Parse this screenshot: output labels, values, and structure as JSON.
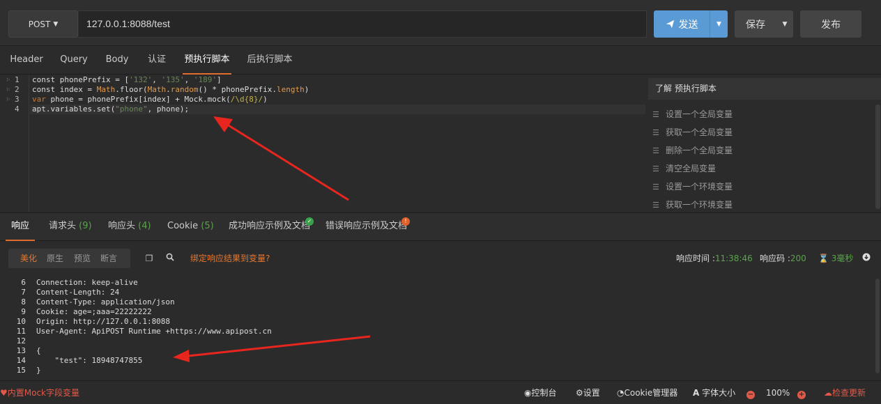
{
  "request": {
    "method": "POST",
    "url": "127.0.0.1:8088/test",
    "send_label": "发送",
    "save_label": "保存",
    "publish_label": "发布"
  },
  "request_tabs": [
    "Header",
    "Query",
    "Body",
    "认证",
    "预执行脚本",
    "后执行脚本"
  ],
  "active_request_tab": "预执行脚本",
  "editor": {
    "line_numbers": [
      "1",
      "2",
      "3",
      "4"
    ],
    "lines": [
      [
        {
          "t": "const phonePrefix = [",
          "c": ""
        },
        {
          "t": "'132'",
          "c": "str"
        },
        {
          "t": ", ",
          "c": ""
        },
        {
          "t": "'135'",
          "c": "str"
        },
        {
          "t": ", ",
          "c": ""
        },
        {
          "t": "'189'",
          "c": "str"
        },
        {
          "t": "]",
          "c": ""
        }
      ],
      [
        {
          "t": "const index = ",
          "c": ""
        },
        {
          "t": "Math",
          "c": "cls"
        },
        {
          "t": ".floor(",
          "c": ""
        },
        {
          "t": "Math",
          "c": "cls"
        },
        {
          "t": ".",
          "c": ""
        },
        {
          "t": "random",
          "c": "prop"
        },
        {
          "t": "() * phonePrefix.",
          "c": ""
        },
        {
          "t": "length",
          "c": "prop"
        },
        {
          "t": ")",
          "c": ""
        }
      ],
      [
        {
          "t": "var",
          "c": "kw"
        },
        {
          "t": " phone = phonePrefix[index] + Mock.mock(",
          "c": ""
        },
        {
          "t": "/\\d{8}/",
          "c": "re"
        },
        {
          "t": ")",
          "c": ""
        }
      ],
      [
        {
          "t": "apt.variables.set(",
          "c": ""
        },
        {
          "t": "\"phone\"",
          "c": "str"
        },
        {
          "t": ", phone);",
          "c": ""
        }
      ]
    ]
  },
  "help_panel": {
    "title": "了解 预执行脚本",
    "items": [
      "设置一个全局变量",
      "获取一个全局变量",
      "删除一个全局变量",
      "清空全局变量",
      "设置一个环境变量",
      "获取一个环境变量"
    ]
  },
  "response_tabs": [
    {
      "label": "响应",
      "count": ""
    },
    {
      "label": "请求头",
      "count": "(9)"
    },
    {
      "label": "响应头",
      "count": "(4)"
    },
    {
      "label": "Cookie",
      "count": "(5)"
    },
    {
      "label": "成功响应示例及文档",
      "count": ""
    },
    {
      "label": "错误响应示例及文档",
      "count": ""
    }
  ],
  "active_response_tab": "响应",
  "view_options": [
    "美化",
    "原生",
    "预览",
    "断言"
  ],
  "active_view_option": "美化",
  "bind_variable_label": "绑定响应结果到变量?",
  "response_meta": {
    "time_label": "响应时间 :",
    "time_value": "11:38:46",
    "code_label": "响应码 :",
    "code_value": "200",
    "duration_value": "3毫秒"
  },
  "response_body": {
    "line_numbers": [
      "6",
      "7",
      "8",
      "9",
      "10",
      "11",
      "12",
      "13",
      "14",
      "15"
    ],
    "lines": [
      "Connection: keep-alive",
      "Content-Length: 24",
      "Content-Type: application/json",
      "Cookie: age=;aaa=22222222",
      "Origin: http://127.0.0.1:8088",
      "User-Agent: ApiPOST Runtime +https://www.apipost.cn",
      "",
      "{",
      "    \"test\": 18948747855",
      "}"
    ]
  },
  "status_bar": {
    "mock_label": "内置Mock字段变量",
    "console_label": "控制台",
    "settings_label": "设置",
    "cookie_manager_label": "Cookie管理器",
    "font_size_label": "字体大小",
    "zoom": "100%",
    "check_update_label": "检查更新"
  },
  "colors": {
    "accent": "#e8772e",
    "send_button": "#5b9bd5",
    "count_green": "#5aa34a",
    "arrow_red": "#e8261e"
  }
}
